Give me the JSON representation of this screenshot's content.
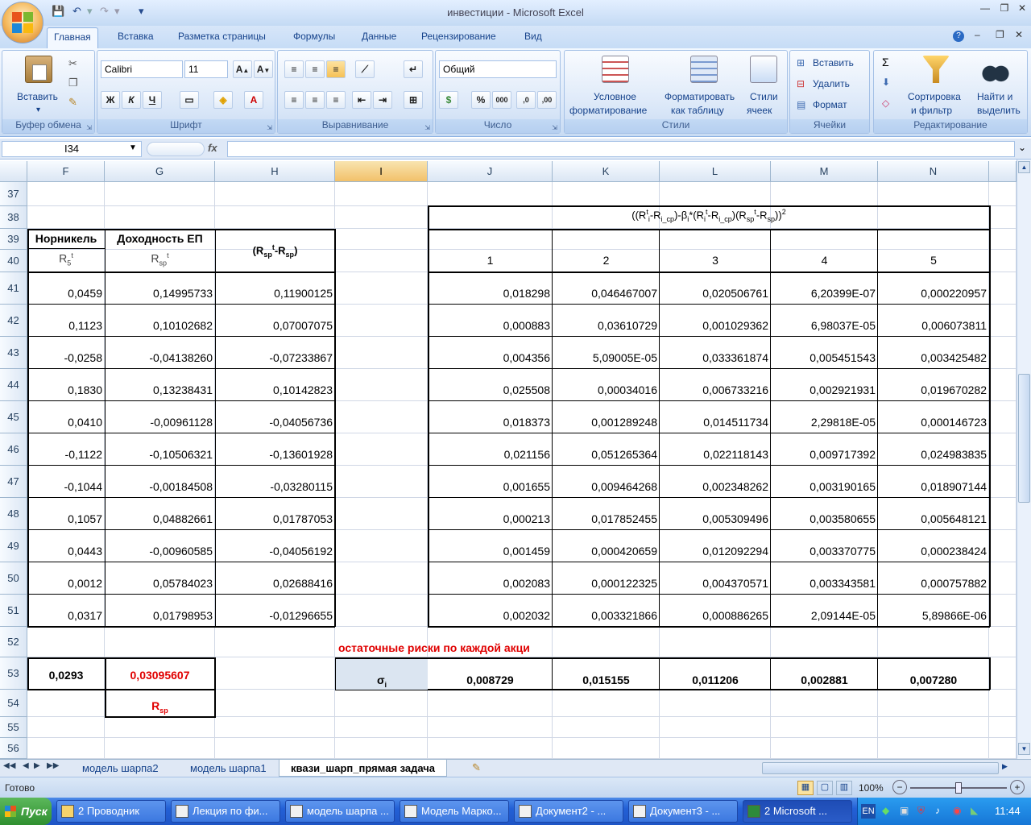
{
  "window": {
    "title": "инвестиции - Microsoft Excel"
  },
  "ribbon_tabs": [
    "Главная",
    "Вставка",
    "Разметка страницы",
    "Формулы",
    "Данные",
    "Рецензирование",
    "Вид"
  ],
  "ribbon": {
    "clipboard": {
      "paste": "Вставить",
      "label": "Буфер обмена"
    },
    "font": {
      "name": "Calibri",
      "size": "11",
      "label": "Шрифт",
      "bold": "Ж",
      "italic": "К",
      "underline": "Ч"
    },
    "alignment": {
      "label": "Выравнивание"
    },
    "number": {
      "format": "Общий",
      "label": "Число",
      "percent": "%",
      "thousands": "000"
    },
    "styles": {
      "conditional": [
        "Условное",
        "форматирование"
      ],
      "format_table": [
        "Форматировать",
        "как таблицу"
      ],
      "cell_styles": [
        "Стили",
        "ячеек"
      ],
      "label": "Стили"
    },
    "cells": {
      "insert": "Вставить",
      "delete": "Удалить",
      "format": "Формат",
      "label": "Ячейки"
    },
    "editing": {
      "sort": [
        "Сортировка",
        "и фильтр"
      ],
      "find": [
        "Найти и",
        "выделить"
      ],
      "label": "Редактирование",
      "sum": "Σ"
    }
  },
  "formula_bar": {
    "name_box": "I34",
    "fx": "fx",
    "value": ""
  },
  "columns": [
    "F",
    "G",
    "H",
    "I",
    "J",
    "K",
    "L",
    "M",
    "N"
  ],
  "rows": [
    "37",
    "38",
    "39",
    "40",
    "41",
    "42",
    "43",
    "44",
    "45",
    "46",
    "47",
    "48",
    "49",
    "50",
    "51",
    "52",
    "53",
    "54",
    "55",
    "56"
  ],
  "headers": {
    "norilsk": "Норникель",
    "r5": {
      "base": "R",
      "sub": "5",
      "sup": "t"
    },
    "portfolio": "Доходность ЕП",
    "rsp": {
      "base": "R",
      "sub": "sp",
      "sup": "t"
    },
    "h_header": {
      "a": "(R",
      "sub1": "sp",
      "sup1": "t",
      "b": "-R",
      "sub2": "sp",
      "c": ")"
    },
    "j_formula": {
      "p1": "((R",
      "s1": "i",
      "t1": "t",
      "p2": "-R",
      "s2": "i_cp",
      "p3": ")-β",
      "s3": "i",
      "p4": "*(R",
      "s4": "i",
      "t2": "t",
      "p5": "-R",
      "s5": "i_cp",
      "p6": ")(R",
      "s6": "sp",
      "t3": "t",
      "p7": "-R",
      "s7": "sp",
      "p8": "))",
      "t4": "2"
    },
    "numbers": [
      "1",
      "2",
      "3",
      "4",
      "5"
    ]
  },
  "table": [
    [
      "0,0459",
      "0,14995733",
      "0,11900125",
      "0,018298",
      "0,046467007",
      "0,020506761",
      "6,20399E-07",
      "0,000220957"
    ],
    [
      "0,1123",
      "0,10102682",
      "0,07007075",
      "0,000883",
      "0,03610729",
      "0,001029362",
      "6,98037E-05",
      "0,006073811"
    ],
    [
      "-0,0258",
      "-0,04138260",
      "-0,07233867",
      "0,004356",
      "5,09005E-05",
      "0,033361874",
      "0,005451543",
      "0,003425482"
    ],
    [
      "0,1830",
      "0,13238431",
      "0,10142823",
      "0,025508",
      "0,00034016",
      "0,006733216",
      "0,002921931",
      "0,019670282"
    ],
    [
      "0,0410",
      "-0,00961128",
      "-0,04056736",
      "0,018373",
      "0,001289248",
      "0,014511734",
      "2,29818E-05",
      "0,000146723"
    ],
    [
      "-0,1122",
      "-0,10506321",
      "-0,13601928",
      "0,021156",
      "0,051265364",
      "0,022118143",
      "0,009717392",
      "0,024983835"
    ],
    [
      "-0,1044",
      "-0,00184508",
      "-0,03280115",
      "0,001655",
      "0,009464268",
      "0,002348262",
      "0,003190165",
      "0,018907144"
    ],
    [
      "0,1057",
      "0,04882661",
      "0,01787053",
      "0,000213",
      "0,017852455",
      "0,005309496",
      "0,003580655",
      "0,005648121"
    ],
    [
      "0,0443",
      "-0,00960585",
      "-0,04056192",
      "0,001459",
      "0,000420659",
      "0,012092294",
      "0,003370775",
      "0,000238424"
    ],
    [
      "0,0012",
      "0,05784023",
      "0,02688416",
      "0,002083",
      "0,000122325",
      "0,004370571",
      "0,003343581",
      "0,000757882"
    ],
    [
      "0,0317",
      "0,01798953",
      "-0,01296655",
      "0,002032",
      "0,003321866",
      "0,000886265",
      "2,09144E-05",
      "5,89866E-06"
    ]
  ],
  "residual_label": "остаточные риски по каждой акци",
  "summary": {
    "f53": "0,0293",
    "g53": "0,03095607",
    "g54": {
      "base": "R",
      "sub": "sp"
    },
    "sigma": {
      "base": "σ",
      "sub": "i"
    },
    "sigmas": [
      "0,008729",
      "0,015155",
      "0,011206",
      "0,002881",
      "0,007280"
    ]
  },
  "sheet_tabs": [
    "модель шарпа2",
    "модель шарпа1",
    "квази_шарп_прямая задача"
  ],
  "active_sheet": "квази_шарп_прямая задача",
  "status": {
    "ready": "Готово",
    "zoom": "100%"
  },
  "taskbar": {
    "start": "Пуск",
    "items": [
      "2 Проводник",
      "Лекция по фи...",
      "модель шарпа ...",
      "Модель Марко...",
      "Документ2 - ...",
      "Документ3 - ...",
      "2 Microsoft ..."
    ],
    "lang": "EN",
    "clock": "11:44"
  }
}
